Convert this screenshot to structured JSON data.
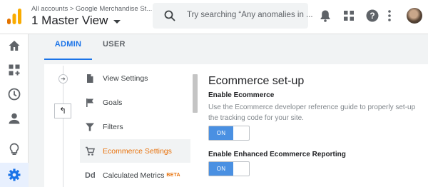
{
  "header": {
    "breadcrumb": "All accounts > Google Merchandise St...",
    "view_title": "1 Master View",
    "search_placeholder": "Try searching “Any anomalies in ..."
  },
  "tabs": [
    {
      "label": "ADMIN",
      "active": true
    },
    {
      "label": "USER",
      "active": false
    }
  ],
  "menu": {
    "items": [
      {
        "label": "View Settings",
        "icon": "document-icon"
      },
      {
        "label": "Goals",
        "icon": "flag-icon"
      },
      {
        "label": "Filters",
        "icon": "filter-icon"
      },
      {
        "label": "Ecommerce Settings",
        "icon": "cart-icon",
        "active": true
      },
      {
        "label": "Calculated Metrics",
        "icon": "dd-icon",
        "badge": "BETA"
      }
    ]
  },
  "panel": {
    "title": "Ecommerce set-up",
    "enable_ecommerce_label": "Enable Ecommerce",
    "enable_ecommerce_desc": "Use the Ecommerce developer reference guide to properly set-up the tracking code for your site.",
    "enable_ecommerce_toggle": "ON",
    "enhanced_label": "Enable Enhanced Ecommerce Reporting",
    "enhanced_toggle": "ON"
  },
  "colors": {
    "accent_blue": "#1a73e8",
    "active_orange": "#e8710a",
    "toggle_on": "#4a90e2",
    "logo_orange": "#f9ab00",
    "logo_dark_orange": "#e37400"
  }
}
